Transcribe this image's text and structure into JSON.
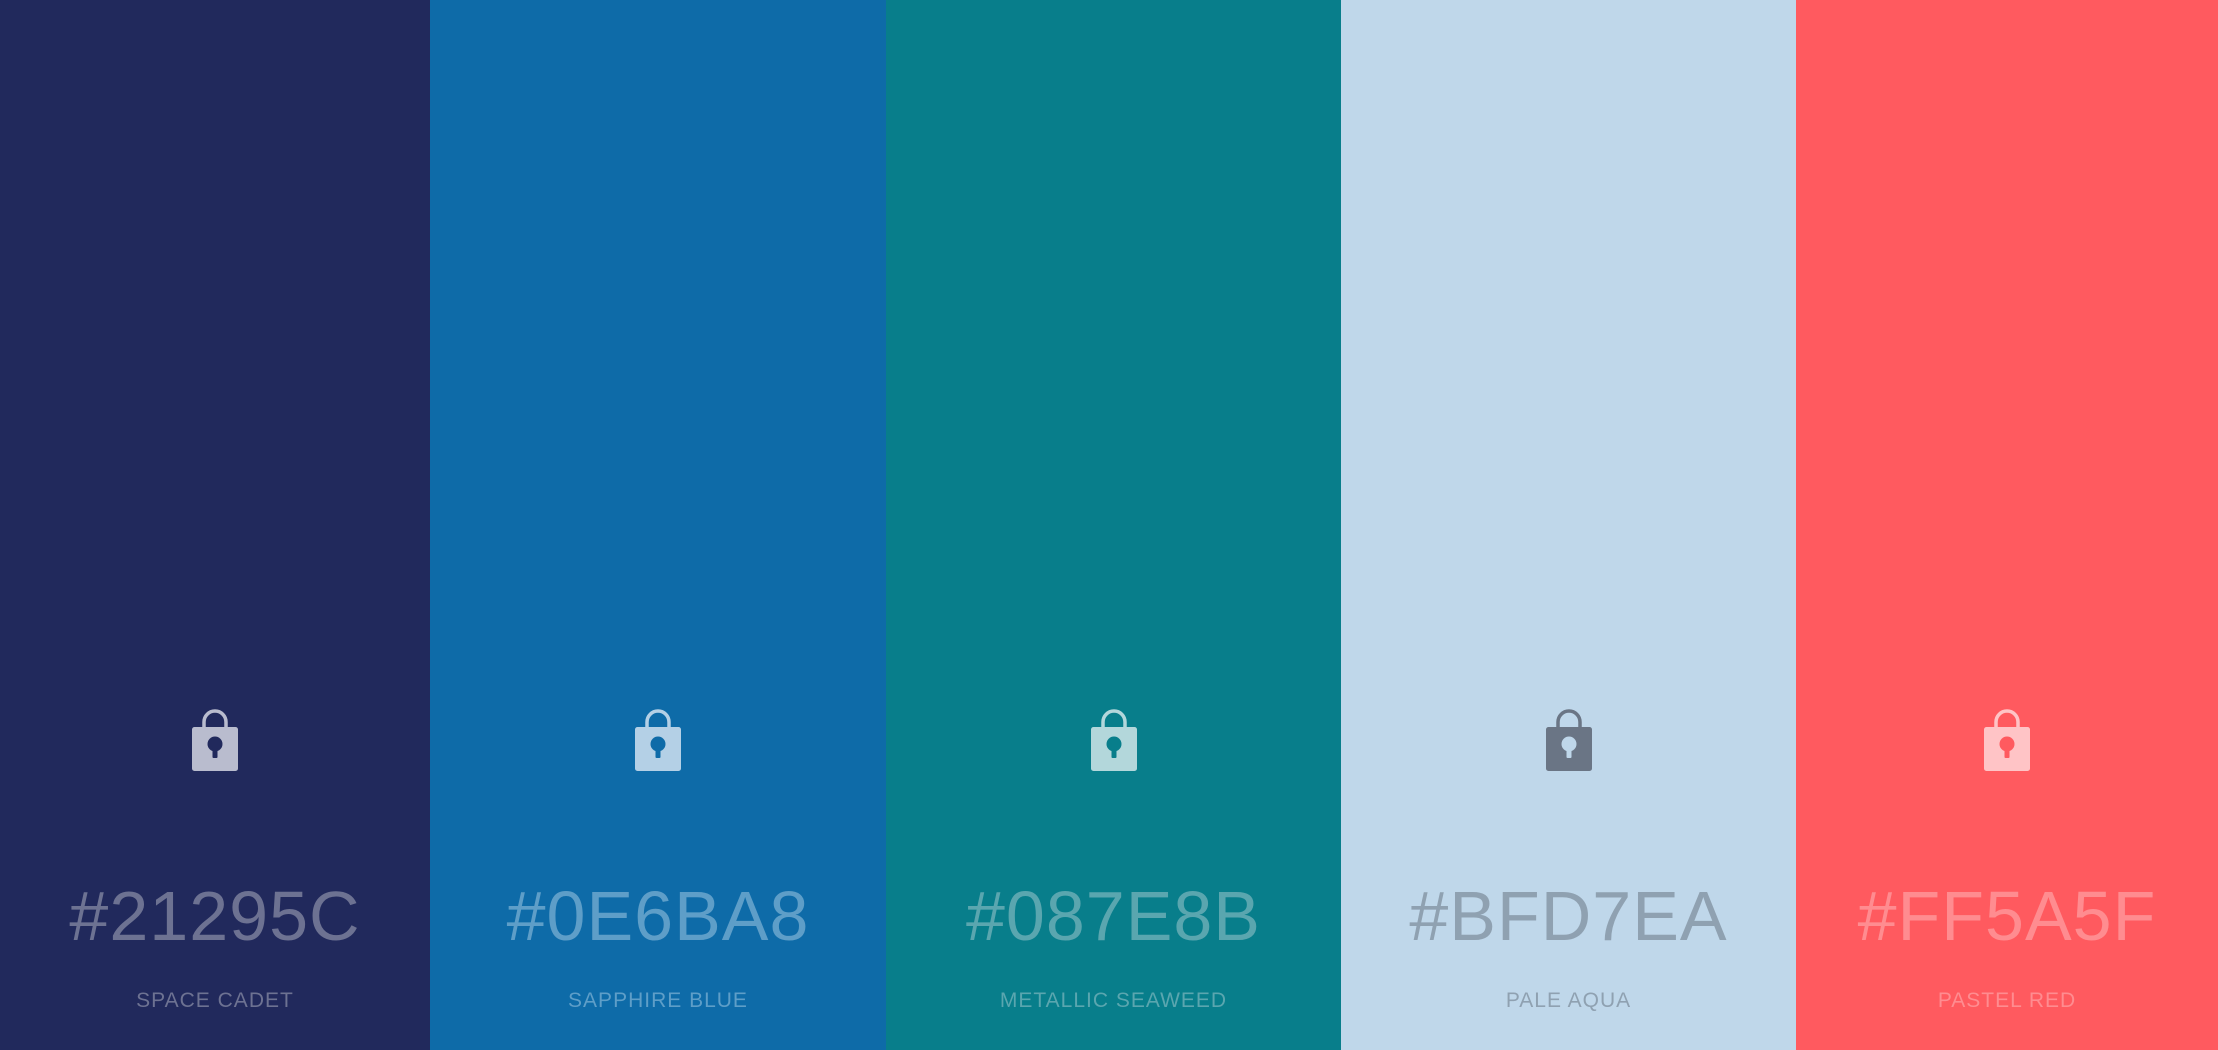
{
  "palette": [
    {
      "hex": "#21295C",
      "name": "SPACE CADET",
      "background": "#21295C",
      "text_color": "#6D7292",
      "icon_color": "#B9BCCE",
      "icon": "lock-icon"
    },
    {
      "hex": "#0E6BA8",
      "name": "SAPPHIRE BLUE",
      "background": "#0E6BA8",
      "text_color": "#5E9EC8",
      "icon_color": "#B4D0E6",
      "icon": "lock-icon"
    },
    {
      "hex": "#087E8B",
      "name": "METALLIC SEAWEED",
      "background": "#087E8B",
      "text_color": "#5AA6AF",
      "icon_color": "#B3D7DB",
      "icon": "lock-icon"
    },
    {
      "hex": "#BFD7EA",
      "name": "PALE AQUA",
      "background": "#BFD7EA",
      "text_color": "#8FA1B1",
      "icon_color": "#6A7585",
      "icon": "lock-icon"
    },
    {
      "hex": "#FF5A5F",
      "name": "PASTEL RED",
      "background": "#FF5A5F",
      "text_color": "#FF8C90",
      "icon_color": "#FFC4C6",
      "icon": "lock-icon"
    }
  ]
}
